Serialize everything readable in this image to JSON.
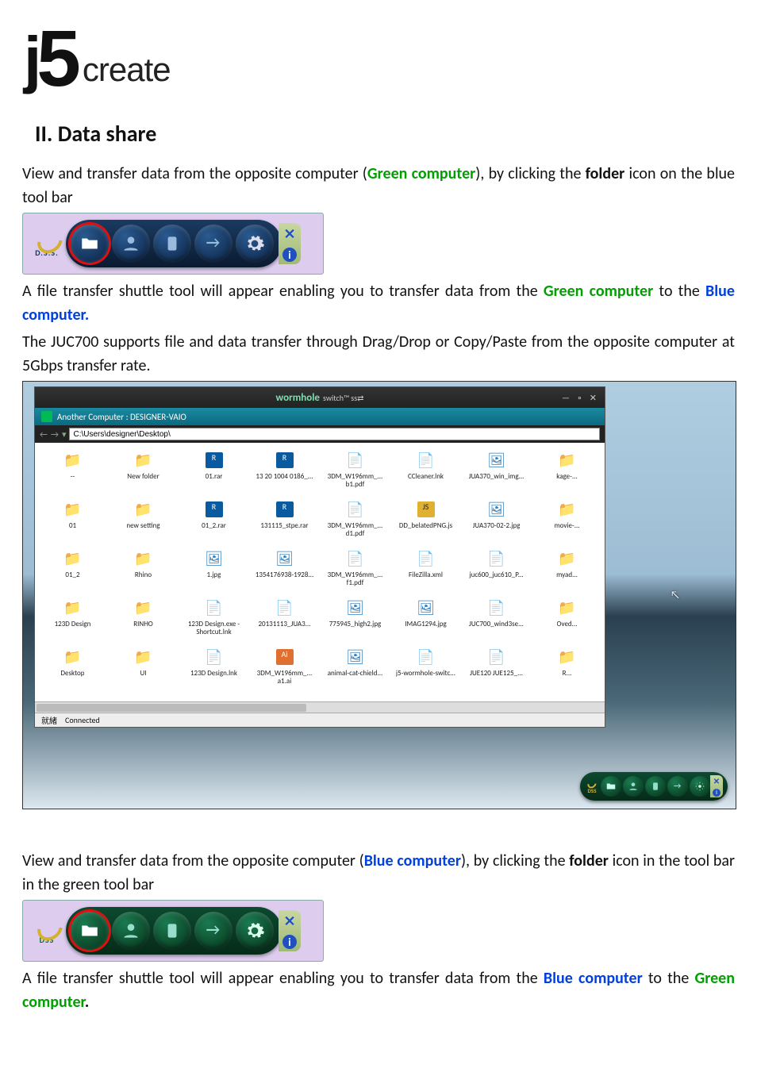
{
  "logo": {
    "create": "create"
  },
  "section_heading": "II.   Data share",
  "p1": {
    "a": "View and transfer data from the opposite computer (",
    "green": "Green computer",
    "b": "), by clicking the ",
    "bold": "folder",
    "c": " icon on the blue tool bar"
  },
  "toolbar_dss": "D.S.S.",
  "toolbar_dss2": "DSS",
  "toolbar_close": "✕",
  "toolbar_info": "i",
  "p2": {
    "a": "A file transfer shuttle tool will appear enabling you to transfer data from the ",
    "green": "Green computer",
    "b": " to the ",
    "blue": "Blue computer."
  },
  "p3": "The JUC700 supports file and data transfer through Drag/Drop or Copy/Paste from the opposite computer at 5Gbps transfer rate.",
  "screenshot": {
    "title": "wormhole",
    "title_sub": "switch™  ss⇄",
    "winbtns": "— ▫ ✕",
    "subbar": "Another Computer : DESIGNER-VAIO",
    "nav_back": "←",
    "nav_fwd": "→",
    "nav_drop": "▾",
    "path": "C:\\Users\\designer\\Desktop\\",
    "status_left": "就緒",
    "status_right": "Connected",
    "files": [
      {
        "t": "folder",
        "n": "--"
      },
      {
        "t": "folder",
        "n": "New folder"
      },
      {
        "t": "rar",
        "n": "01.rar"
      },
      {
        "t": "rar",
        "n": "13 20 1004 0186_..."
      },
      {
        "t": "pdf",
        "n": "3DM_W196mm_...",
        "n2": "b1.pdf"
      },
      {
        "t": "file",
        "n": "CCleaner.lnk"
      },
      {
        "t": "img",
        "n": "JUA370_win_img..."
      },
      {
        "t": "folder",
        "n": "kage-..."
      },
      {
        "t": "folder",
        "n": "01"
      },
      {
        "t": "folder",
        "n": "new setting"
      },
      {
        "t": "rar",
        "n": "01_2.rar"
      },
      {
        "t": "rar",
        "n": "131115_stpe.rar"
      },
      {
        "t": "pdf",
        "n": "3DM_W196mm_...",
        "n2": "d1.pdf"
      },
      {
        "t": "js",
        "n": "DD_belatedPNG.js"
      },
      {
        "t": "img",
        "n": "JUA370-02-2.jpg"
      },
      {
        "t": "folder",
        "n": "movie-..."
      },
      {
        "t": "folder",
        "n": "01_2"
      },
      {
        "t": "folder",
        "n": "Rhino"
      },
      {
        "t": "img",
        "n": "1.jpg"
      },
      {
        "t": "img",
        "n": "1354176938-1928..."
      },
      {
        "t": "pdf",
        "n": "3DM_W196mm_...",
        "n2": "f1.pdf"
      },
      {
        "t": "file",
        "n": "FileZilla.xml"
      },
      {
        "t": "file",
        "n": "juc600_juc610_P..."
      },
      {
        "t": "folder",
        "n": "myad..."
      },
      {
        "t": "folder",
        "n": "123D Design"
      },
      {
        "t": "folder",
        "n": "RINHO"
      },
      {
        "t": "file",
        "n": "123D Design.exe -",
        "n2": "Shortcut.lnk"
      },
      {
        "t": "pdf",
        "n": "20131113_JUA3..."
      },
      {
        "t": "img",
        "n": "775945_high2.jpg"
      },
      {
        "t": "img",
        "n": "IMAG1294.jpg"
      },
      {
        "t": "pdf",
        "n": "JUC700_wind3se..."
      },
      {
        "t": "folder",
        "n": "Oved..."
      },
      {
        "t": "folder",
        "n": "Desktop"
      },
      {
        "t": "folder",
        "n": "UI"
      },
      {
        "t": "file",
        "n": "123D Design.lnk"
      },
      {
        "t": "ai",
        "n": "3DM_W196mm_...",
        "n2": "a1.ai"
      },
      {
        "t": "img",
        "n": "animal-cat-chield..."
      },
      {
        "t": "file",
        "n": "j5-wormhole-switc..."
      },
      {
        "t": "pdf",
        "n": "JUE120 JUE125_..."
      },
      {
        "t": "folder",
        "n": "R..."
      }
    ],
    "cursor": "↖"
  },
  "p4": {
    "a": "View and transfer data from the opposite computer (",
    "blue": "Blue computer",
    "b": "), by clicking the ",
    "bold": "folder",
    "c": " icon in the tool bar in the green tool bar"
  },
  "p5": {
    "a": "A file transfer shuttle tool will appear enabling you to transfer data from the ",
    "blue": "Blue computer",
    "b": " to the ",
    "green": "Green computer",
    "dot": "."
  }
}
